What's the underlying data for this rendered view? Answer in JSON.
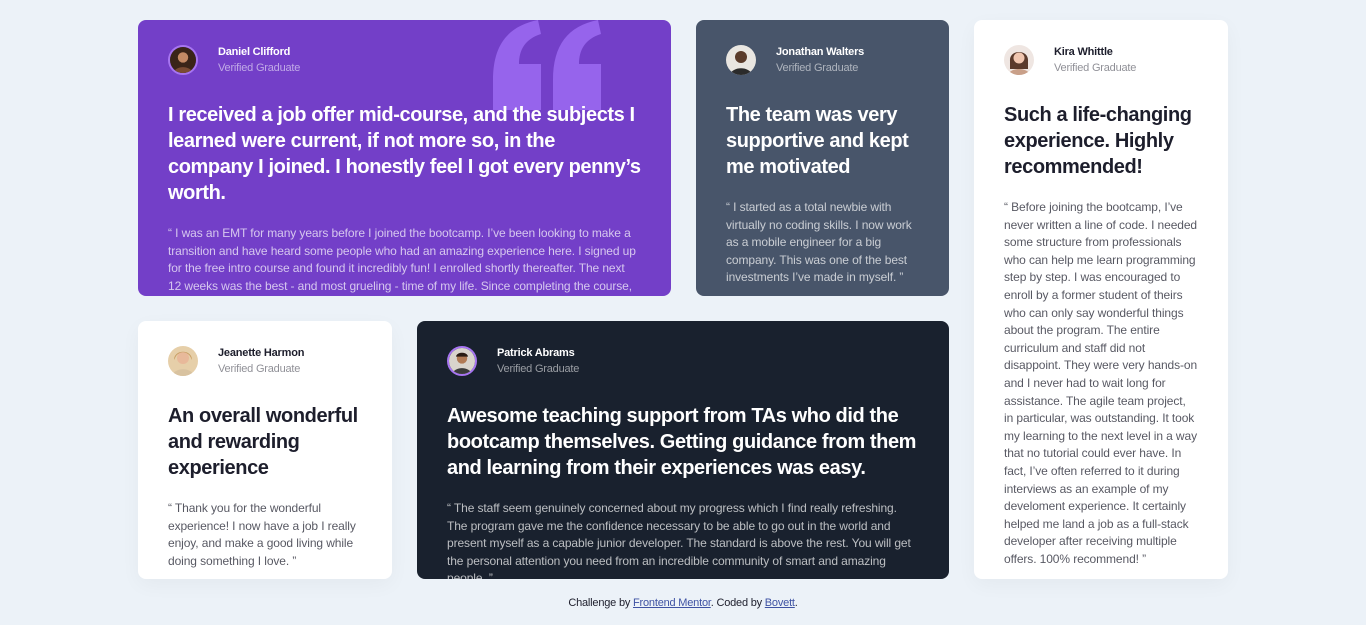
{
  "testimonials": [
    {
      "name": "Daniel Clifford",
      "role": "Verified Graduate",
      "headline": "I received a job offer mid-course, and the subjects I learned were current, if not more so, in the company I joined. I honestly feel I got every penny’s worth.",
      "quote": "“ I was an EMT for many years before I joined the bootcamp. I’ve been looking to make a transition and have heard some people who had an amazing experience here. I signed up for the free intro course and found it incredibly fun! I enrolled shortly thereafter. The next 12 weeks was the best - and most grueling - time of my life. Since completing the course, I’ve successfully switched careers, working as a Software Engineer at a VR startup. ”",
      "background": "#733fc8"
    },
    {
      "name": "Jonathan Walters",
      "role": "Verified Graduate",
      "headline": "The team was very supportive and kept me motivated",
      "quote": "“ I started as a total newbie with virtually no coding skills. I now work as a mobile engineer for a big company. This was one of the best investments I’ve made in myself. ”",
      "background": "#48556a"
    },
    {
      "name": "Jeanette Harmon",
      "role": "Verified Graduate",
      "headline": "An overall wonderful and rewarding experience",
      "quote": "“ Thank you for the wonderful experience! I now have a job I really enjoy, and make a good living while doing something I love. ”",
      "background": "#ffffff"
    },
    {
      "name": "Patrick Abrams",
      "role": "Verified Graduate",
      "headline": "Awesome teaching support from TAs who did the bootcamp themselves. Getting guidance from them and learning from their experiences was easy.",
      "quote": "“ The staff seem genuinely concerned about my progress which I find really refreshing. The program gave me the confidence necessary to be able to go out in the world and present myself as a capable junior developer. The standard is above the rest. You will get the personal attention you need from an incredible community of smart and amazing people. ”",
      "background": "#19212e"
    },
    {
      "name": "Kira Whittle",
      "role": "Verified Graduate",
      "headline": "Such a life-changing experience. Highly recommended!",
      "quote": "“ Before joining the bootcamp, I’ve never written a line of code. I needed some structure from professionals who can help me learn programming step by step. I was encouraged to enroll by a former student of theirs who can only say wonderful things about the program. The entire curriculum and staff did not disappoint. They were very hands-on and I never had to wait long for assistance. The agile team project, in particular, was outstanding. It took my learning to the next level in a way that no tutorial could ever have. In fact, I’ve often referred to it during interviews as an example of my develoment experience. It certainly helped me land a job as a full-stack developer after receiving multiple offers. 100% recommend! ”",
      "background": "#ffffff"
    }
  ],
  "icons": {
    "quote_mark": "quote-mark-icon"
  },
  "footer": {
    "prefix": "Challenge by",
    "link1": "Frontend Mentor",
    "middle": ". Coded by",
    "link2": "Bovett",
    "suffix": "."
  },
  "colors": {
    "page_background": "#ecf2f8",
    "accent_purple": "#733fc8",
    "avatar_ring": "#a775f1",
    "link": "#3e52a3"
  }
}
